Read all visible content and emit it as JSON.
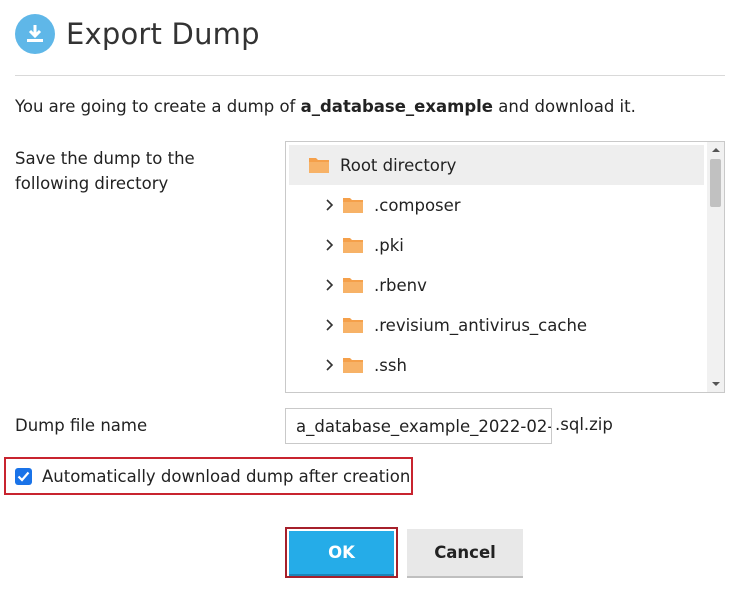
{
  "dialog": {
    "title": "Export Dump",
    "header_icon": "download-icon",
    "accent_color": "#5fb7e8"
  },
  "intro": {
    "prefix": "You are going to create a dump of ",
    "database": "a_database_example",
    "suffix": " and download it."
  },
  "directory": {
    "label_line1": "Save the dump to the",
    "label_line2": "following directory",
    "root": {
      "label": "Root directory",
      "icon": "folder-icon"
    },
    "items": [
      {
        "label": ".composer",
        "icon": "folder-icon",
        "expander": "chevron-right-icon"
      },
      {
        "label": ".pki",
        "icon": "folder-icon",
        "expander": "chevron-right-icon"
      },
      {
        "label": ".rbenv",
        "icon": "folder-icon",
        "expander": "chevron-right-icon"
      },
      {
        "label": ".revisium_antivirus_cache",
        "icon": "folder-icon",
        "expander": "chevron-right-icon"
      },
      {
        "label": ".ssh",
        "icon": "folder-icon",
        "expander": "chevron-right-icon"
      }
    ]
  },
  "file_name": {
    "label": "Dump file name",
    "value": "a_database_example_2022-02-",
    "suffix": ".sql.zip"
  },
  "auto_download": {
    "label": "Automatically download dump after creation",
    "checked": true
  },
  "buttons": {
    "ok": "OK",
    "cancel": "Cancel",
    "ok_color": "#25ace8"
  }
}
